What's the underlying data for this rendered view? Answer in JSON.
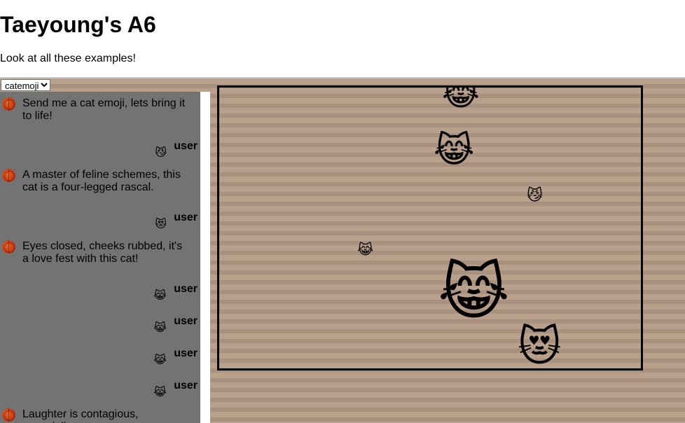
{
  "page": {
    "title": "Taeyoung's A6",
    "subtitle": "Look at all these examples!"
  },
  "selector": {
    "selected": "catemoji",
    "options": [
      "catemoji"
    ]
  },
  "chat": {
    "messages": [
      {
        "role": "bot",
        "text": "Send me a cat emoji, lets bring it to life!"
      },
      {
        "role": "user",
        "name": "user",
        "emoji": "😼"
      },
      {
        "role": "bot",
        "text": "A master of feline schemes, this cat is a four-legged rascal."
      },
      {
        "role": "user",
        "name": "user",
        "emoji": "😻"
      },
      {
        "role": "bot",
        "text": "Eyes closed, cheeks rubbed, it's a love fest with this cat!"
      },
      {
        "role": "user",
        "name": "user",
        "emoji": "😹"
      },
      {
        "role": "user",
        "name": "user",
        "emoji": "😹"
      },
      {
        "role": "user",
        "name": "user",
        "emoji": "😹"
      },
      {
        "role": "user",
        "name": "user",
        "emoji": "😹"
      },
      {
        "role": "bot",
        "text": "Laughter is contagious, especially"
      }
    ]
  },
  "stage": {
    "cats": [
      {
        "emoji": "😹"
      },
      {
        "emoji": "😹"
      },
      {
        "emoji": "😼"
      },
      {
        "emoji": "😹"
      },
      {
        "emoji": "😹"
      },
      {
        "emoji": "😻"
      }
    ]
  },
  "colors": {
    "chat_bg": "#737373",
    "stage_border": "#000000",
    "stripe_light": "#b9a08a",
    "stripe_dark": "#a8917e"
  }
}
